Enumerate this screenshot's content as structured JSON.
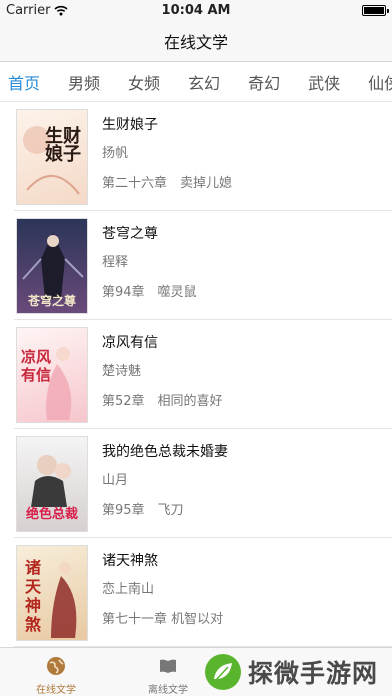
{
  "status_bar": {
    "carrier": "Carrier",
    "time": "10:04 AM"
  },
  "nav": {
    "title": "在线文学"
  },
  "tabs": [
    {
      "label": "首页",
      "active": true
    },
    {
      "label": "男频",
      "active": false
    },
    {
      "label": "女频",
      "active": false
    },
    {
      "label": "玄幻",
      "active": false
    },
    {
      "label": "奇幻",
      "active": false
    },
    {
      "label": "武侠",
      "active": false
    },
    {
      "label": "仙侠",
      "active": false
    }
  ],
  "books": [
    {
      "title": "生财娘子",
      "author": "扬帆",
      "chapter": "第二十六章　卖掉儿媳",
      "cover_text": "生财娘子",
      "cover_colors": [
        "#fdf3ea",
        "#f4d9c7"
      ]
    },
    {
      "title": "苍穹之尊",
      "author": "程释",
      "chapter": "第94章　噬灵鼠",
      "cover_text": "苍穹之尊",
      "cover_colors": [
        "#2b3558",
        "#6a4a7a"
      ]
    },
    {
      "title": "凉风有信",
      "author": "楚诗魅",
      "chapter": "第52章　相同的喜好",
      "cover_text": "凉风有信",
      "cover_colors": [
        "#fff5f5",
        "#f5c6cc"
      ]
    },
    {
      "title": "我的绝色总裁未婚妻",
      "author": "山月",
      "chapter": "第95章　飞刀",
      "cover_text": "绝色总裁",
      "cover_colors": [
        "#f4f4f4",
        "#d7d0d0"
      ]
    },
    {
      "title": "诸天神煞",
      "author": "恋上南山",
      "chapter": "第七十一章 机智以对",
      "cover_text": "诸天神煞",
      "cover_colors": [
        "#f7eedb",
        "#e8c9a2"
      ]
    }
  ],
  "tab_bar": [
    {
      "label": "在线文学",
      "icon": "globe-icon",
      "active": true
    },
    {
      "label": "离线文学",
      "icon": "book-icon",
      "active": false
    }
  ],
  "watermark": {
    "text": "探微手游网"
  },
  "colors": {
    "accent": "#2b8cd6",
    "tab_active": "#b07a3c",
    "watermark_green": "#5ab52e"
  }
}
